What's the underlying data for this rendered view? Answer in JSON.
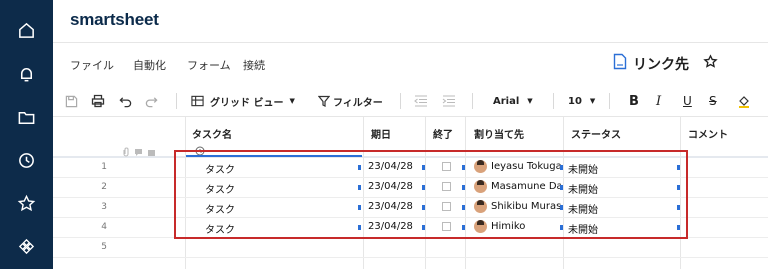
{
  "app": {
    "logo": "smartsheet"
  },
  "nav": {
    "icons": [
      "home-icon",
      "bell-icon",
      "folder-icon",
      "clock-icon",
      "star-icon",
      "apps-icon"
    ]
  },
  "menu": {
    "items": [
      "ファイル",
      "自動化",
      "フォーム",
      "接続"
    ]
  },
  "doc": {
    "title": "リンク先"
  },
  "toolbar": {
    "view_label": "グリッド ビュー",
    "filter_label": "フィルター",
    "font": "Arial",
    "size": "10",
    "bold": "B",
    "italic": "I",
    "underline": "U",
    "strike": "S"
  },
  "grid": {
    "columns": [
      "タスク名",
      "期日",
      "終了",
      "割り当て先",
      "ステータス",
      "コメント"
    ],
    "rows": [
      {
        "num": "1",
        "task": "タスク",
        "date": "23/04/28",
        "assignee": "Ieyasu Tokugawa",
        "status": "未開始"
      },
      {
        "num": "2",
        "task": "タスク",
        "date": "23/04/28",
        "assignee": "Masamune Date",
        "status": "未開始"
      },
      {
        "num": "3",
        "task": "タスク",
        "date": "23/04/28",
        "assignee": "Shikibu Murasaki",
        "status": "未開始"
      },
      {
        "num": "4",
        "task": "タスク",
        "date": "23/04/28",
        "assignee": "Himiko",
        "status": "未開始"
      },
      {
        "num": "5",
        "task": "",
        "date": "",
        "assignee": "",
        "status": ""
      }
    ]
  },
  "colors": {
    "nav_bg": "#0d2b4a",
    "accent": "#2b6fd6",
    "highlight": "#c72a2a"
  }
}
